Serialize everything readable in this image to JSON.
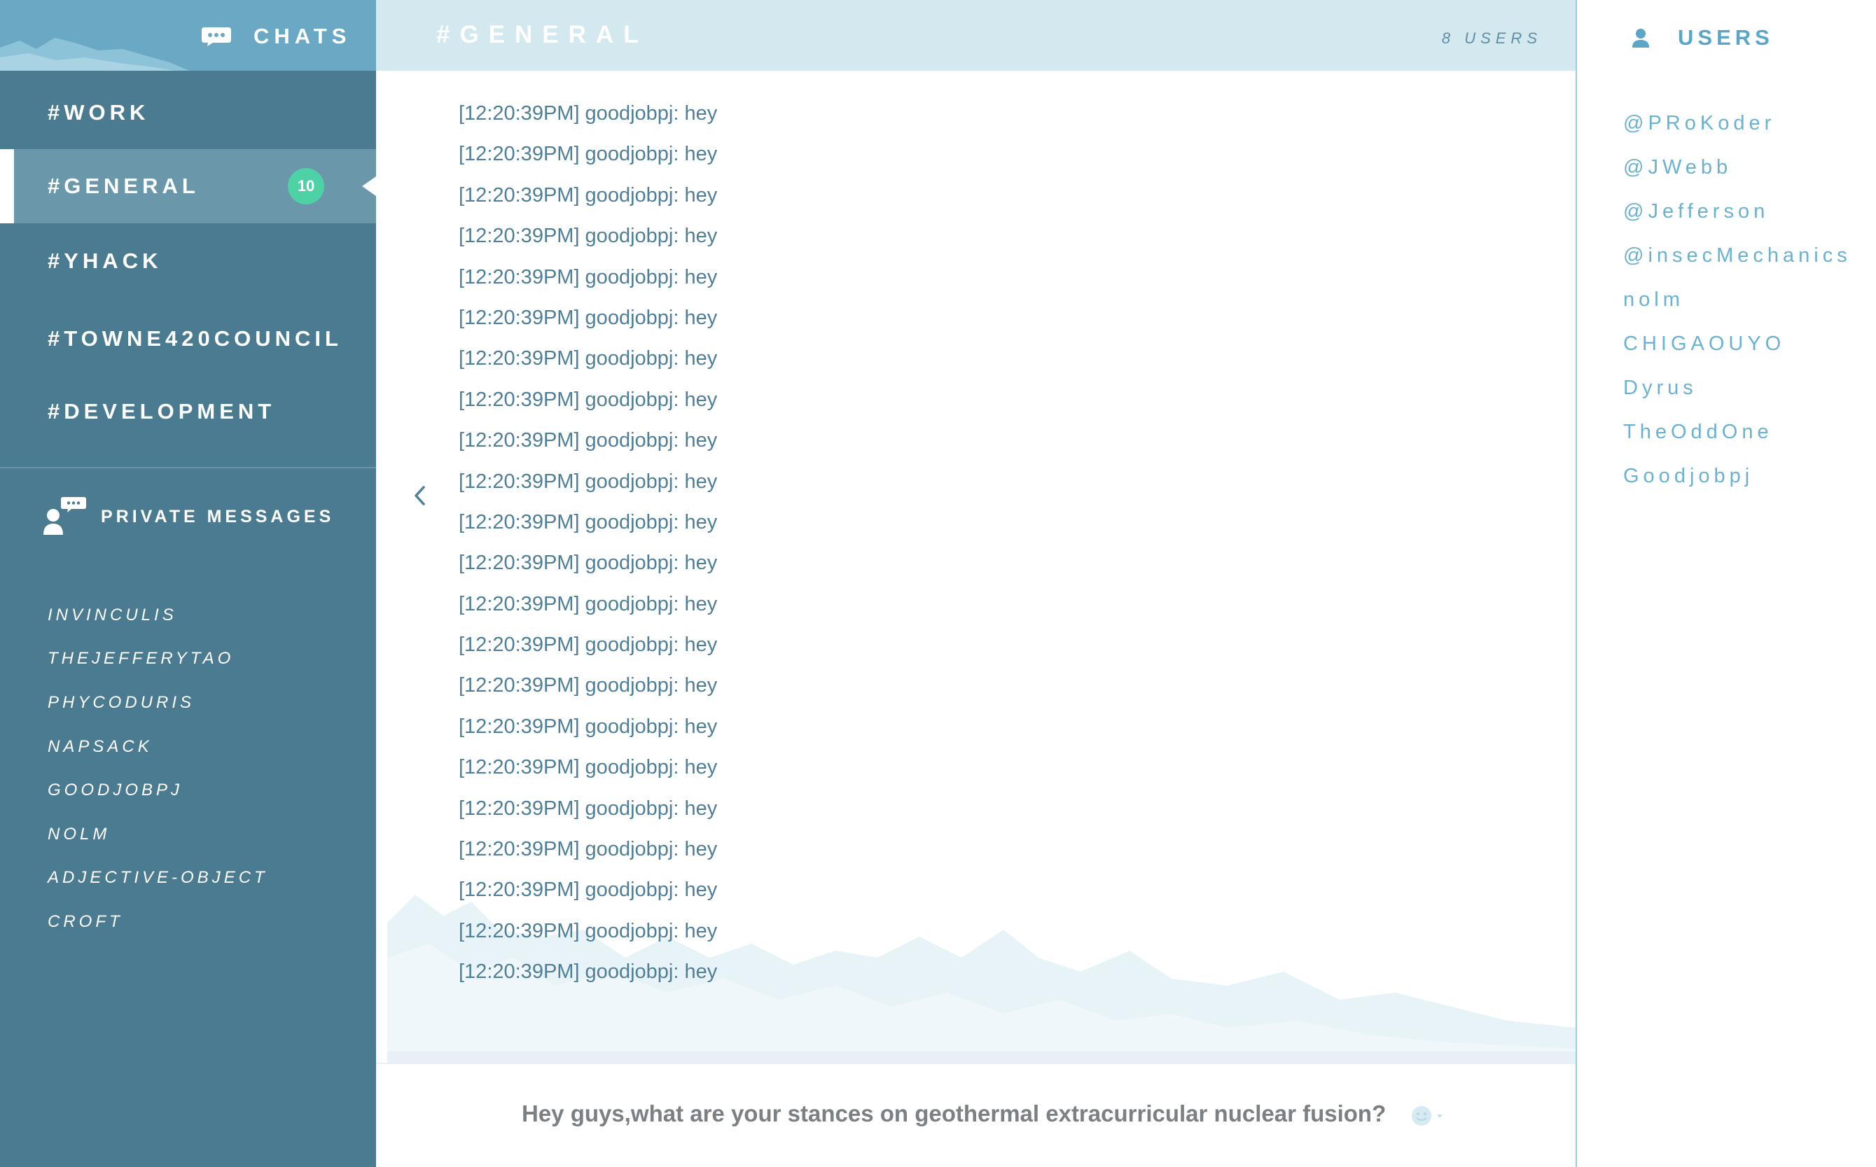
{
  "sidebar": {
    "header": {
      "title": "CHATS"
    },
    "channels": [
      {
        "label": "#WORK"
      },
      {
        "label": "#GENERAL",
        "badge": "10",
        "active": true
      },
      {
        "label": "#YHACK"
      },
      {
        "label": "#TOWNE420COUNCIL"
      },
      {
        "label": "#DEVELOPMENT"
      }
    ],
    "private_messages": {
      "title": "PRIVATE MESSAGES",
      "items": [
        {
          "label": "INVINCULIS"
        },
        {
          "label": "THEJEFFERYTAO"
        },
        {
          "label": "PHYCODURIS"
        },
        {
          "label": "NAPSACK"
        },
        {
          "label": "GOODJOBPJ"
        },
        {
          "label": "NOLM"
        },
        {
          "label": "ADJECTIVE-OBJECT"
        },
        {
          "label": "CROFT"
        }
      ]
    }
  },
  "main": {
    "title": "#GENERAL",
    "user_count": "8 USERS",
    "messages": [
      "[12:20:39PM] goodjobpj: hey",
      "[12:20:39PM] goodjobpj: hey",
      "[12:20:39PM] goodjobpj: hey",
      "[12:20:39PM] goodjobpj: hey",
      "[12:20:39PM] goodjobpj: hey",
      "[12:20:39PM] goodjobpj: hey",
      "[12:20:39PM] goodjobpj: hey",
      "[12:20:39PM] goodjobpj: hey",
      "[12:20:39PM] goodjobpj: hey",
      "[12:20:39PM] goodjobpj: hey",
      "[12:20:39PM] goodjobpj: hey",
      "[12:20:39PM] goodjobpj: hey",
      "[12:20:39PM] goodjobpj: hey",
      "[12:20:39PM] goodjobpj: hey",
      "[12:20:39PM] goodjobpj: hey",
      "[12:20:39PM] goodjobpj: hey",
      "[12:20:39PM] goodjobpj: hey",
      "[12:20:39PM] goodjobpj: hey",
      "[12:20:39PM] goodjobpj: hey",
      "[12:20:39PM] goodjobpj: hey",
      "[12:20:39PM] goodjobpj: hey",
      "[12:20:39PM] goodjobpj: hey"
    ],
    "composer": {
      "value": "Hey guys,what are your stances on geothermal extracurricular nuclear fusion?"
    }
  },
  "users": {
    "title": "USERS",
    "items": [
      "@PRoKoder",
      "@JWebb",
      "@Jefferson",
      "@insecMechanics",
      "nolm",
      "CHIGAOUYO",
      "Dyrus",
      "TheOddOne",
      "Goodjobpj"
    ]
  },
  "colors": {
    "sidebar_bg": "#4b7b91",
    "sidebar_header_bg": "#6aa8c4",
    "active_channel_bg": "#6b97aa",
    "badge_bg": "#4fd1a6",
    "main_header_bg": "#d3e8ef",
    "message_text": "#4e7f98",
    "user_text": "#6ab2d3"
  },
  "icons": {
    "chats": "speech-bubble-icon",
    "private_messages": "person-with-speech-bubble-icon",
    "users": "person-icon",
    "scroll": "chevron-left-icon",
    "emoji": "smiley-dropdown-icon"
  }
}
